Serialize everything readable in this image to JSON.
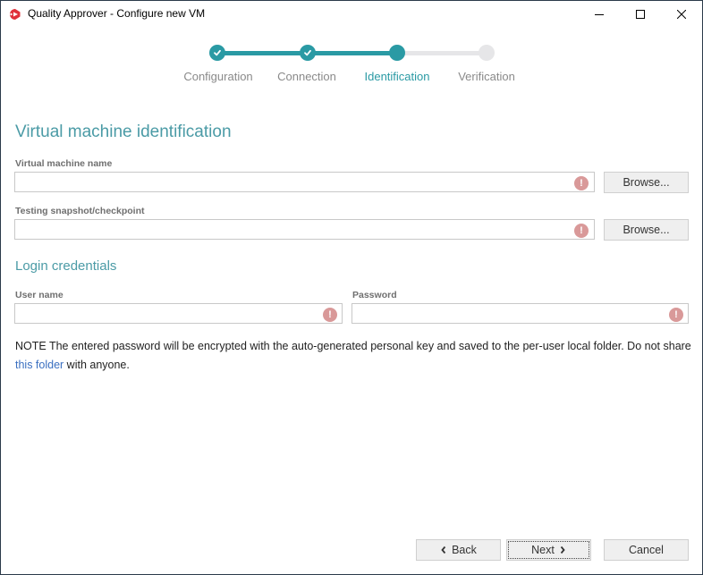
{
  "window": {
    "title": "Quality Approver - Configure new VM",
    "app_icon": "quality-approver-logo-icon",
    "controls": {
      "minimize": "minimize-icon",
      "maximize": "maximize-icon",
      "close": "close-icon"
    }
  },
  "stepper": {
    "steps": [
      {
        "label": "Configuration",
        "state": "done"
      },
      {
        "label": "Connection",
        "state": "done"
      },
      {
        "label": "Identification",
        "state": "active"
      },
      {
        "label": "Verification",
        "state": "pending"
      }
    ],
    "colors": {
      "accent": "#2a9aa4",
      "pending": "#e6e6e8"
    }
  },
  "identification": {
    "heading": "Virtual machine identification",
    "vm_name": {
      "label": "Virtual machine name",
      "value": "",
      "browse_label": "Browse..."
    },
    "snapshot": {
      "label": "Testing snapshot/checkpoint",
      "value": "",
      "browse_label": "Browse..."
    }
  },
  "credentials": {
    "heading": "Login credentials",
    "username": {
      "label": "User name",
      "value": ""
    },
    "password": {
      "label": "Password",
      "value": ""
    }
  },
  "note": {
    "prefix": "NOTE The entered password will be encrypted with the auto-generated personal key and saved to the per-user local folder. Do not share ",
    "link": "this folder",
    "suffix": " with anyone."
  },
  "validation": {
    "error_glyph": "!",
    "error_color": "#d99999"
  },
  "footer": {
    "back_label": "Back",
    "next_label": "Next",
    "cancel_label": "Cancel"
  }
}
